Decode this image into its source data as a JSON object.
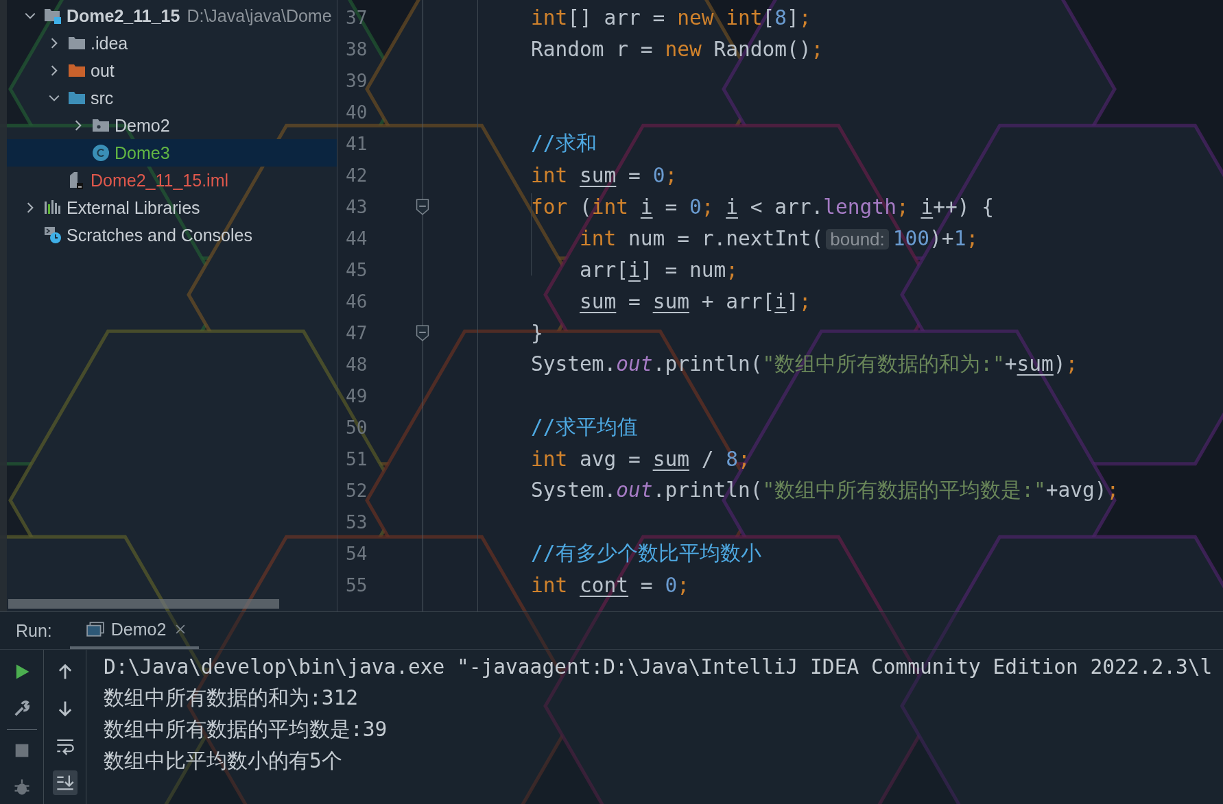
{
  "project_tree": [
    {
      "name": "Dome2_11_15",
      "path": "D:\\Java\\java\\Dome",
      "kind": "project",
      "expanded": true,
      "selected": false,
      "children": [
        {
          "name": ".idea",
          "kind": "folder",
          "expanded": false,
          "selected": false
        },
        {
          "name": "out",
          "kind": "excluded-folder",
          "expanded": false,
          "selected": false
        },
        {
          "name": "src",
          "kind": "source-folder",
          "expanded": true,
          "selected": false,
          "children": [
            {
              "name": "Demo2",
              "kind": "package",
              "expanded": false,
              "selected": false
            },
            {
              "name": "Dome3",
              "kind": "class",
              "selected": true,
              "color": "#62b543"
            }
          ]
        },
        {
          "name": "Dome2_11_15.iml",
          "kind": "module-file",
          "selected": false,
          "color": "#e0584c"
        }
      ]
    },
    {
      "name": "External Libraries",
      "kind": "libraries",
      "expanded": false,
      "selected": false
    },
    {
      "name": "Scratches and Consoles",
      "kind": "scratches",
      "selected": false
    }
  ],
  "editor": {
    "lines": [
      {
        "number": "37",
        "tokens": [
          {
            "kind": "keyword",
            "text": "int"
          },
          {
            "kind": "plain",
            "text": "[] arr = "
          },
          {
            "kind": "keyword",
            "text": "new int"
          },
          {
            "kind": "plain",
            "text": "["
          },
          {
            "kind": "number",
            "text": "8"
          },
          {
            "kind": "plain",
            "text": "]"
          },
          {
            "kind": "keyword",
            "text": ";"
          }
        ]
      },
      {
        "number": "38",
        "tokens": [
          {
            "kind": "plain",
            "text": "Random r = "
          },
          {
            "kind": "keyword",
            "text": "new "
          },
          {
            "kind": "plain",
            "text": "Random()"
          },
          {
            "kind": "keyword",
            "text": ";"
          }
        ]
      },
      {
        "number": "39"
      },
      {
        "number": "40"
      },
      {
        "number": "41",
        "tokens": [
          {
            "kind": "comment",
            "text": "//求和"
          }
        ]
      },
      {
        "number": "42",
        "tokens": [
          {
            "kind": "keyword",
            "text": "int "
          },
          {
            "kind": "variable",
            "text": "sum"
          },
          {
            "kind": "plain",
            "text": " = "
          },
          {
            "kind": "number",
            "text": "0"
          },
          {
            "kind": "keyword",
            "text": ";"
          }
        ]
      },
      {
        "number": "43",
        "fold_marker": true,
        "tokens": [
          {
            "kind": "keyword",
            "text": "for "
          },
          {
            "kind": "plain",
            "text": "("
          },
          {
            "kind": "keyword",
            "text": "int "
          },
          {
            "kind": "variable",
            "text": "i"
          },
          {
            "kind": "plain",
            "text": " = "
          },
          {
            "kind": "number",
            "text": "0"
          },
          {
            "kind": "keyword",
            "text": "; "
          },
          {
            "kind": "variable",
            "text": "i"
          },
          {
            "kind": "plain",
            "text": " < arr."
          },
          {
            "kind": "member",
            "text": "length"
          },
          {
            "kind": "keyword",
            "text": "; "
          },
          {
            "kind": "variable",
            "text": "i"
          },
          {
            "kind": "plain",
            "text": "++) {"
          }
        ]
      },
      {
        "number": "44",
        "tokens": [
          {
            "kind": "keyword",
            "text": "    int "
          },
          {
            "kind": "plain",
            "text": "num = r.nextInt("
          },
          {
            "kind": "hint",
            "text": "bound:"
          },
          {
            "kind": "number",
            "text": "100"
          },
          {
            "kind": "plain",
            "text": ")+"
          },
          {
            "kind": "number",
            "text": "1"
          },
          {
            "kind": "keyword",
            "text": ";"
          }
        ]
      },
      {
        "number": "45",
        "tokens": [
          {
            "kind": "plain",
            "text": "    arr["
          },
          {
            "kind": "variable",
            "text": "i"
          },
          {
            "kind": "plain",
            "text": "] = num"
          },
          {
            "kind": "keyword",
            "text": ";"
          }
        ]
      },
      {
        "number": "46",
        "tokens": [
          {
            "kind": "variable",
            "text": "    sum"
          },
          {
            "kind": "plain",
            "text": " = "
          },
          {
            "kind": "variable",
            "text": "sum"
          },
          {
            "kind": "plain",
            "text": " + arr["
          },
          {
            "kind": "variable",
            "text": "i"
          },
          {
            "kind": "plain",
            "text": "]"
          },
          {
            "kind": "keyword",
            "text": ";"
          }
        ]
      },
      {
        "number": "47",
        "fold_marker": true,
        "tokens": [
          {
            "kind": "plain",
            "text": "}"
          }
        ]
      },
      {
        "number": "48",
        "tokens": [
          {
            "kind": "plain",
            "text": "System."
          },
          {
            "kind": "field",
            "text": "out"
          },
          {
            "kind": "plain",
            "text": ".println("
          },
          {
            "kind": "string",
            "text": "\"数组中所有数据的和为:\""
          },
          {
            "kind": "plain",
            "text": "+"
          },
          {
            "kind": "variable",
            "text": "sum"
          },
          {
            "kind": "plain",
            "text": ")"
          },
          {
            "kind": "keyword",
            "text": ";"
          }
        ]
      },
      {
        "number": "49"
      },
      {
        "number": "50",
        "tokens": [
          {
            "kind": "comment",
            "text": "//求平均值"
          }
        ]
      },
      {
        "number": "51",
        "tokens": [
          {
            "kind": "keyword",
            "text": "int "
          },
          {
            "kind": "plain",
            "text": "avg = "
          },
          {
            "kind": "variable",
            "text": "sum"
          },
          {
            "kind": "plain",
            "text": " / "
          },
          {
            "kind": "number",
            "text": "8"
          },
          {
            "kind": "keyword",
            "text": ";"
          }
        ]
      },
      {
        "number": "52",
        "tokens": [
          {
            "kind": "plain",
            "text": "System."
          },
          {
            "kind": "field",
            "text": "out"
          },
          {
            "kind": "plain",
            "text": ".println("
          },
          {
            "kind": "string",
            "text": "\"数组中所有数据的平均数是:\""
          },
          {
            "kind": "plain",
            "text": "+avg)"
          },
          {
            "kind": "keyword",
            "text": ";"
          }
        ]
      },
      {
        "number": "53"
      },
      {
        "number": "54",
        "tokens": [
          {
            "kind": "comment",
            "text": "//有多少个数比平均数小"
          }
        ]
      },
      {
        "number": "55",
        "tokens": [
          {
            "kind": "keyword",
            "text": "int "
          },
          {
            "kind": "variable",
            "text": "cont"
          },
          {
            "kind": "plain",
            "text": " = "
          },
          {
            "kind": "number",
            "text": "0"
          },
          {
            "kind": "keyword",
            "text": ";"
          }
        ]
      }
    ]
  },
  "run_panel": {
    "label": "Run:",
    "tabs": [
      {
        "label": "Demo2",
        "selected": true
      }
    ],
    "console_lines": [
      "D:\\Java\\develop\\bin\\java.exe \"-javaagent:D:\\Java\\IntelliJ IDEA Community Edition 2022.2.3\\l",
      "数组中所有数据的和为:312",
      "数组中所有数据的平均数是:39",
      "数组中比平均数小的有5个"
    ]
  }
}
